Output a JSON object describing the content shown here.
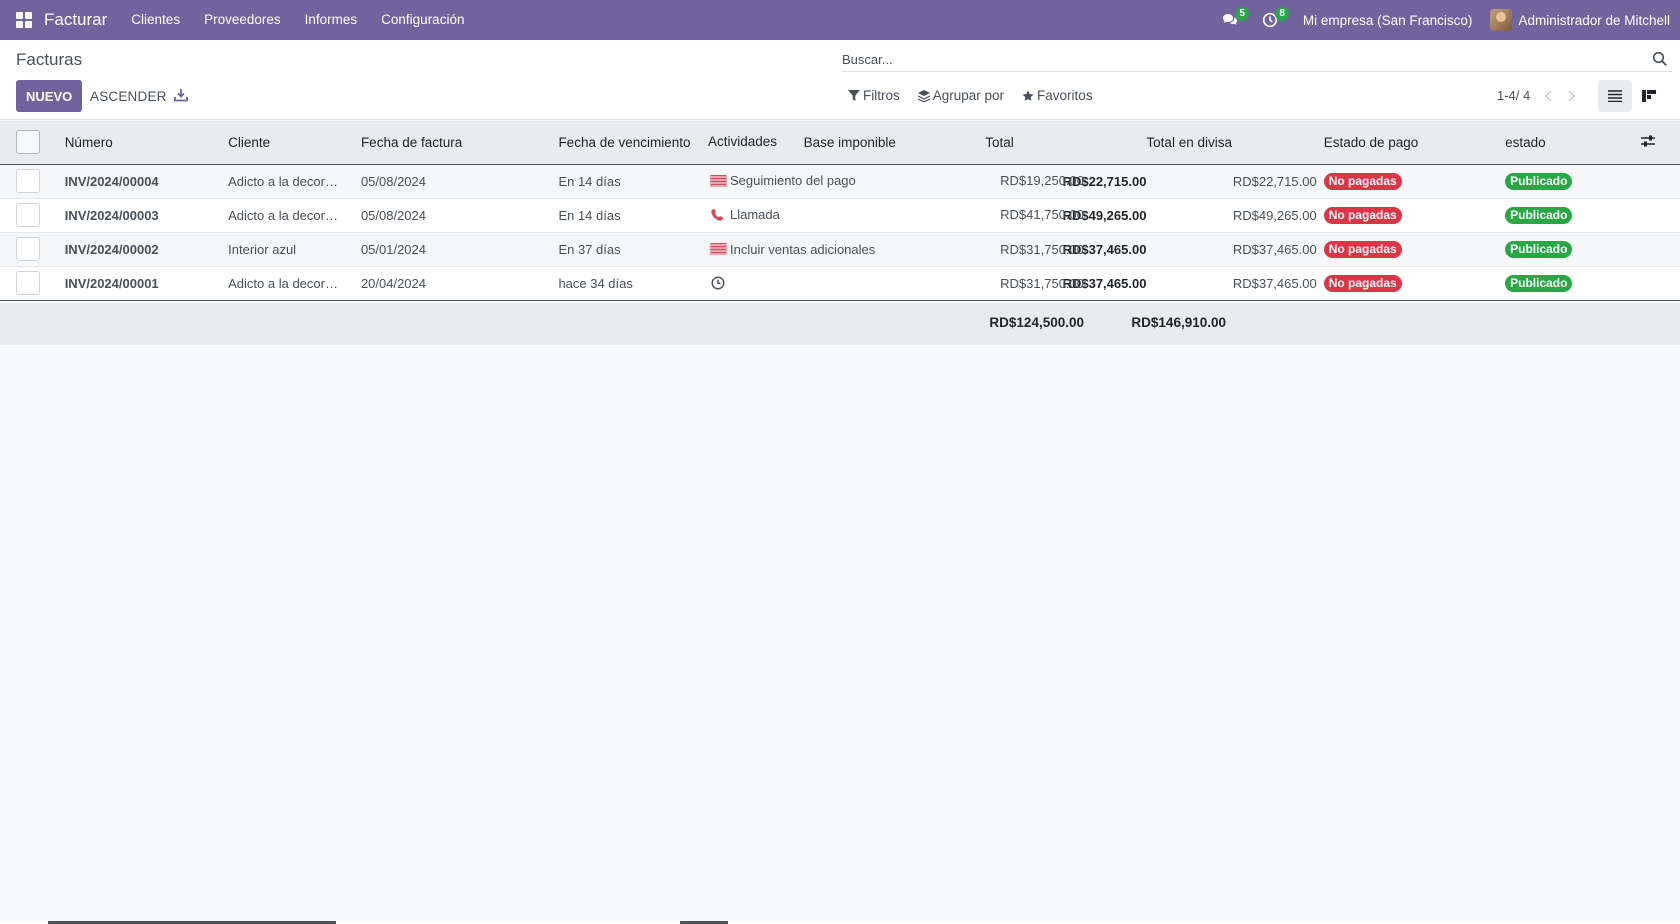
{
  "navbar": {
    "brand": "Facturar",
    "menu": [
      "Clientes",
      "Proveedores",
      "Informes",
      "Configuración"
    ],
    "messages_count": "5",
    "activities_count": "8",
    "company": "Mi empresa (San Francisco)",
    "user": "Administrador de Mitchell"
  },
  "control_panel": {
    "title": "Facturas",
    "search_placeholder": "Buscar...",
    "new_button": "NUEVO",
    "upload_button": "ASCENDER",
    "filters": "Filtros",
    "group_by": "Agrupar por",
    "favorites": "Favoritos",
    "pager": "1-4/ 4"
  },
  "table": {
    "headers": {
      "number": "Número",
      "customer": "Cliente",
      "invoice_date": "Fecha de factura",
      "due_date": "Fecha de vencimiento",
      "activities": "Actividades",
      "tax_base": "Base imponible",
      "total": "Total",
      "total_currency": "Total en divisa",
      "payment_state": "Estado de pago",
      "state": "estado"
    },
    "rows": [
      {
        "number": "INV/2024/00004",
        "customer": "Adicto a la decoración",
        "invoice_date": "05/08/2024",
        "due_date": "En 14 días",
        "activity": "Seguimiento del pago",
        "activity_icon": "email-icon",
        "tax_base": "RD$19,250.00",
        "total": "RD$22,715.00",
        "total_currency": "RD$22,715.00",
        "payment_state": "No pagadas",
        "state": "Publicado"
      },
      {
        "number": "INV/2024/00003",
        "customer": "Adicto a la decoración",
        "invoice_date": "05/08/2024",
        "due_date": "En 14 días",
        "activity": "Llamada",
        "activity_icon": "phone-icon",
        "tax_base": "RD$41,750.00",
        "total": "RD$49,265.00",
        "total_currency": "RD$49,265.00",
        "payment_state": "No pagadas",
        "state": "Publicado"
      },
      {
        "number": "INV/2024/00002",
        "customer": "Interior azul",
        "invoice_date": "05/01/2024",
        "due_date": "En 37 días",
        "activity": "Incluir ventas adicionales",
        "activity_icon": "email-icon",
        "tax_base": "RD$31,750.00",
        "total": "RD$37,465.00",
        "total_currency": "RD$37,465.00",
        "payment_state": "No pagadas",
        "state": "Publicado"
      },
      {
        "number": "INV/2024/00001",
        "customer": "Adicto a la decoración",
        "invoice_date": "20/04/2024",
        "due_date": "hace 34 días",
        "activity": "",
        "activity_icon": "clock-icon",
        "tax_base": "RD$31,750.00",
        "total": "RD$37,465.00",
        "total_currency": "RD$37,465.00",
        "payment_state": "No pagadas",
        "state": "Publicado"
      }
    ],
    "totals": {
      "tax_base": "RD$124,500.00",
      "total": "RD$146,910.00"
    }
  },
  "colors": {
    "brand": "#71639e",
    "danger": "#dc3545",
    "success": "#28a745",
    "overdue": "#d44c59"
  }
}
